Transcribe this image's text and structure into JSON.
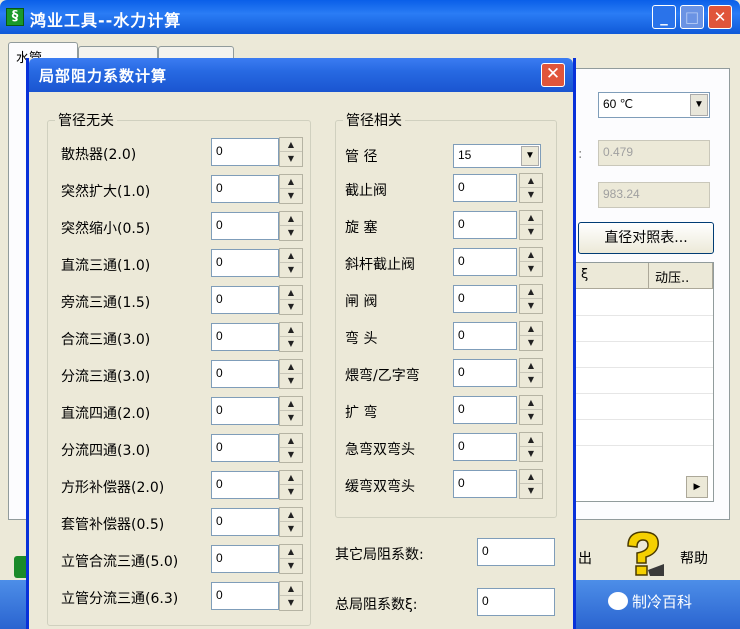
{
  "main_window": {
    "title": "鸿业工具--水力计算",
    "app_icon": "app-icon",
    "tab_label": "水管",
    "temp_value": "60 ℃",
    "density_value": "0.479",
    "viscosity_value": "983.24",
    "diameter_table_button": "直径对照表...",
    "grid_headers": [
      "ξ",
      "动压.."
    ],
    "exit_label": "出",
    "help_label": "帮助"
  },
  "dialog": {
    "title": "局部阻力系数计算",
    "group_left": {
      "label": "管径无关",
      "items": [
        {
          "label": "散热器(2.0)",
          "value": "0"
        },
        {
          "label": "突然扩大(1.0)",
          "value": "0"
        },
        {
          "label": "突然缩小(0.5)",
          "value": "0"
        },
        {
          "label": "直流三通(1.0)",
          "value": "0"
        },
        {
          "label": "旁流三通(1.5)",
          "value": "0"
        },
        {
          "label": "合流三通(3.0)",
          "value": "0"
        },
        {
          "label": "分流三通(3.0)",
          "value": "0"
        },
        {
          "label": "直流四通(2.0)",
          "value": "0"
        },
        {
          "label": "分流四通(3.0)",
          "value": "0"
        },
        {
          "label": "方形补偿器(2.0)",
          "value": "0"
        },
        {
          "label": "套管补偿器(0.5)",
          "value": "0"
        },
        {
          "label": "立管合流三通(5.0)",
          "value": "0"
        },
        {
          "label": "立管分流三通(6.3)",
          "value": "0"
        }
      ]
    },
    "group_right": {
      "label": "管径相关",
      "diameter_label": "管    径",
      "diameter_value": "15",
      "items": [
        {
          "label": "截止阀",
          "value": "0"
        },
        {
          "label": "旋    塞",
          "value": "0"
        },
        {
          "label": "斜杆截止阀",
          "value": "0"
        },
        {
          "label": "闸    阀",
          "value": "0"
        },
        {
          "label": "弯    头",
          "value": "0"
        },
        {
          "label": "煨弯/乙字弯",
          "value": "0"
        },
        {
          "label": "扩    弯",
          "value": "0"
        },
        {
          "label": "急弯双弯头",
          "value": "0"
        },
        {
          "label": "缓弯双弯头",
          "value": "0"
        }
      ]
    },
    "other_label": "其它局阻系数:",
    "other_value": "0",
    "total_label": "总局阻系数ξ:",
    "total_value": "0"
  },
  "watermark": "制冷百科",
  "colors": {
    "titlebar": "#0a5fe8",
    "dialog_title": "#2769e2",
    "face": "#ece9d8",
    "close": "#e0553a"
  }
}
